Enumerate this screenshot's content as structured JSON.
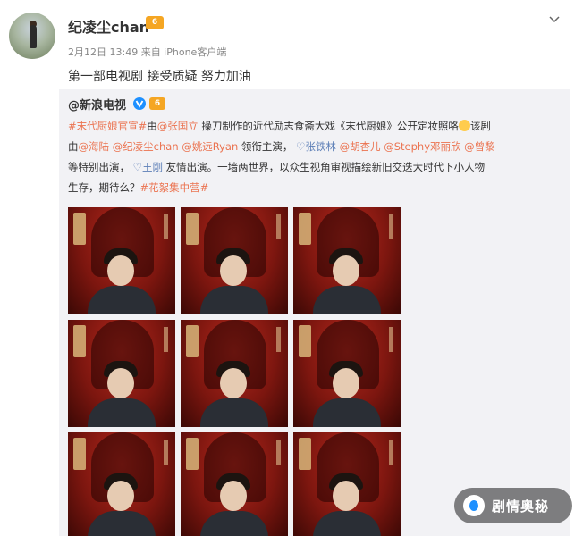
{
  "post": {
    "author": "纪凌尘chan",
    "vip_badge": "6",
    "meta": "2月12日 13:49 来自 iPhone客户端",
    "text": "第一部电视剧 接受质疑 努力加油"
  },
  "repost": {
    "author": "@新浪电视",
    "vip_badge": "6",
    "lines": [
      [
        {
          "t": "#末代厨娘官宣#",
          "c": "link"
        },
        {
          "t": "由",
          "c": ""
        },
        {
          "t": "@张国立",
          "c": "link"
        },
        {
          "t": " 操刀制作的近代励志食斋大戏《末代厨娘》公开定妆照咯",
          "c": ""
        },
        {
          "t": "",
          "c": "emoji"
        },
        {
          "t": "该剧",
          "c": ""
        }
      ],
      [
        {
          "t": "由",
          "c": ""
        },
        {
          "t": "@海陆",
          "c": "link"
        },
        {
          "t": " ",
          "c": ""
        },
        {
          "t": "@纪凌尘chan",
          "c": "link"
        },
        {
          "t": " ",
          "c": ""
        },
        {
          "t": "@姚远Ryan",
          "c": "link"
        },
        {
          "t": " 领衔主演， ",
          "c": ""
        },
        {
          "t": "♡张铁林",
          "c": "link blue"
        },
        {
          "t": " ",
          "c": ""
        },
        {
          "t": "@胡杏儿",
          "c": "link"
        },
        {
          "t": " ",
          "c": ""
        },
        {
          "t": "@Stephy邓丽欣",
          "c": "link"
        },
        {
          "t": " ",
          "c": ""
        },
        {
          "t": "@曾黎",
          "c": "link"
        }
      ],
      [
        {
          "t": "等特别出演， ",
          "c": ""
        },
        {
          "t": "♡王刚",
          "c": "link blue"
        },
        {
          "t": " 友情出演。一墙两世界，以众生视角审视描绘新旧交迭大时代下小人物",
          "c": ""
        }
      ],
      [
        {
          "t": "生存，期待么？",
          "c": ""
        },
        {
          "t": "#花絮集中营#",
          "c": "link"
        }
      ]
    ]
  },
  "watermark": {
    "text": "剧情奥秘"
  },
  "icons": {
    "more": "chevron-down-icon",
    "verified": "verified-v-icon",
    "watermark": "drama-logo-icon"
  },
  "colors": {
    "link": "#eb7350",
    "link_blue": "#5d7fb7",
    "repost_bg": "#f2f2f5",
    "vip": "#f5a623",
    "verify": "#1e90ff"
  }
}
